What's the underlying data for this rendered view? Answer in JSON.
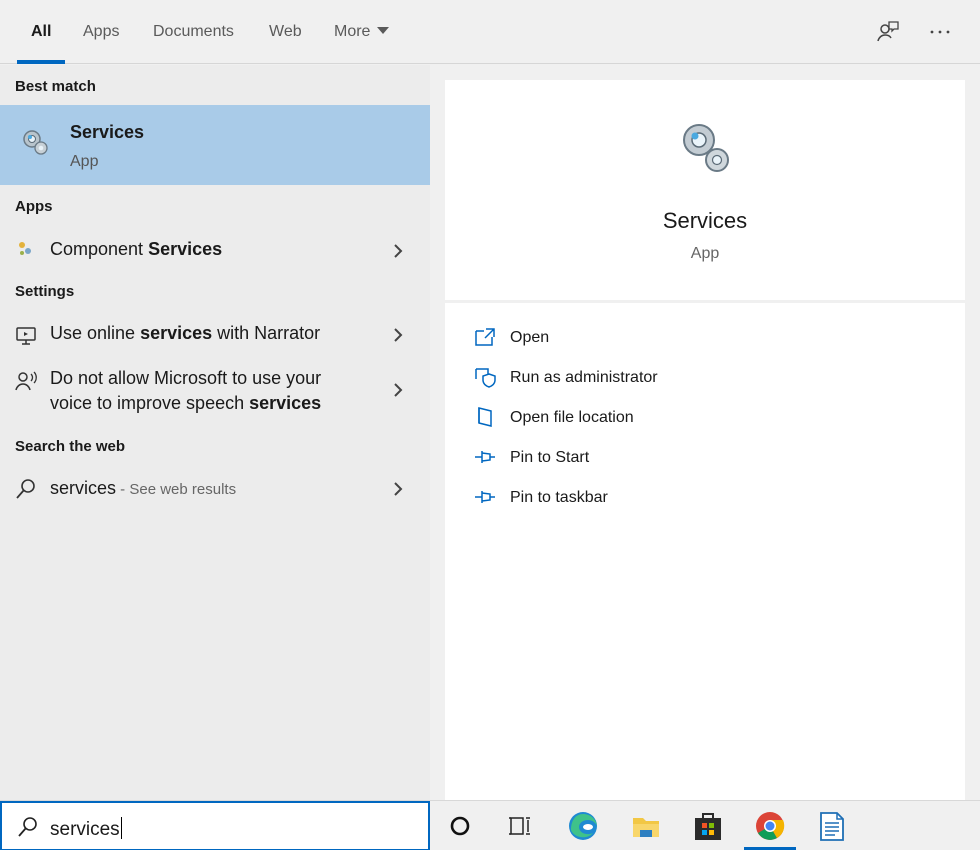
{
  "tabs": [
    {
      "label": "All"
    },
    {
      "label": "Apps"
    },
    {
      "label": "Documents"
    },
    {
      "label": "Web"
    },
    {
      "label": "More"
    }
  ],
  "top_icons": [
    "feedback-icon",
    "more-options-icon"
  ],
  "left": {
    "best_match_title": "Best match",
    "best": {
      "title": "Services",
      "subtitle": "App",
      "icon": "services-gears-icon"
    },
    "apps_title": "Apps",
    "apps": [
      {
        "pre": "Component ",
        "bold": "Services",
        "post": "",
        "icon": "component-services-icon"
      }
    ],
    "settings_title": "Settings",
    "settings": [
      {
        "pre": "Use online ",
        "bold": "services",
        "post": " with Narrator",
        "icon": "narrator-icon"
      },
      {
        "line1": "Do not allow Microsoft to use your",
        "pre2": "voice to improve speech ",
        "bold2": "services",
        "icon": "speech-icon"
      }
    ],
    "web_title": "Search the web",
    "web": {
      "query": "services",
      "suffix": " - See web results",
      "icon": "search-icon"
    }
  },
  "preview": {
    "title": "Services",
    "subtitle": "App",
    "icon": "services-gears-icon",
    "actions": [
      {
        "label": "Open",
        "icon": "open-icon"
      },
      {
        "label": "Run as administrator",
        "icon": "shield-icon"
      },
      {
        "label": "Open file location",
        "icon": "file-location-icon"
      },
      {
        "label": "Pin to Start",
        "icon": "pin-icon"
      },
      {
        "label": "Pin to taskbar",
        "icon": "pin-icon"
      }
    ]
  },
  "search": {
    "value": "services"
  },
  "taskbar": [
    "cortana-icon",
    "task-view-icon",
    "edge-icon",
    "file-explorer-icon",
    "store-icon",
    "chrome-icon",
    "notepad-document-icon"
  ],
  "colors": {
    "accent": "#0067c0",
    "selected": "#a9cbe8"
  }
}
